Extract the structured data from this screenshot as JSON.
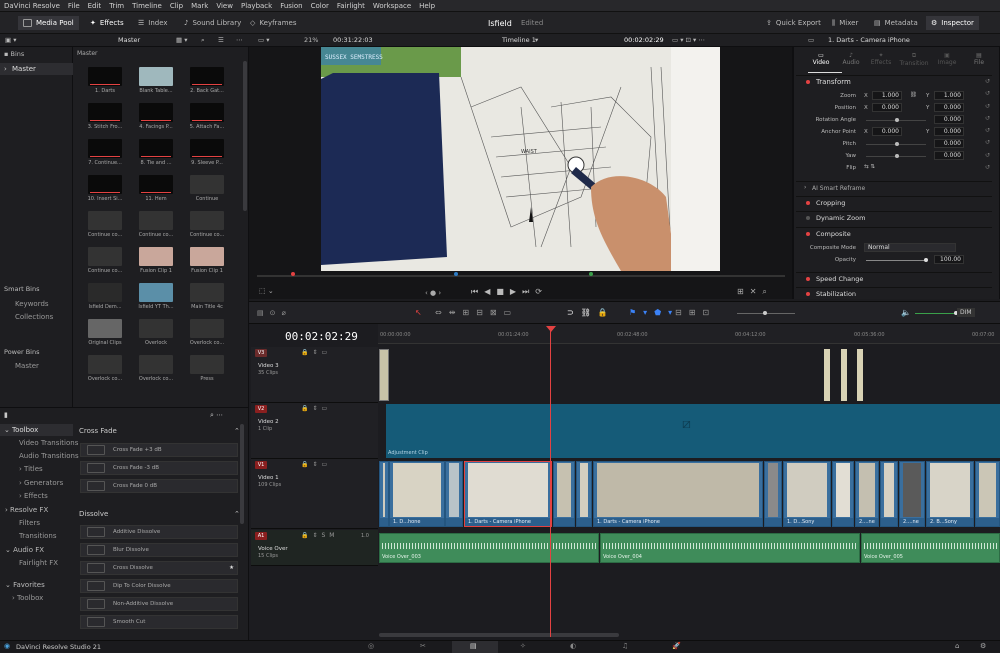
{
  "menubar": {
    "items": [
      "DaVinci Resolve",
      "File",
      "Edit",
      "Trim",
      "Timeline",
      "Clip",
      "Mark",
      "View",
      "Playback",
      "Fusion",
      "Color",
      "Fairlight",
      "Workspace",
      "Help"
    ]
  },
  "toolbar": {
    "media_pool": "Media Pool",
    "effects": "Effects",
    "index": "Index",
    "sound_library": "Sound Library",
    "keyframes": "Keyframes",
    "project_name": "Isfield",
    "project_status": "Edited",
    "quick_export": "Quick Export",
    "mixer": "Mixer",
    "metadata": "Metadata",
    "inspector": "Inspector"
  },
  "subbar": {
    "bin_name": "Master",
    "zoom": "21%",
    "source_tc": "00:31:22:03",
    "timeline_name": "Timeline 1",
    "record_tc": "00:02:02:29",
    "clip_name": "1. Darts - Camera iPhone"
  },
  "bins": {
    "header": "Bins",
    "master": "Master",
    "smart_bins": "Smart Bins",
    "smart_items": [
      "Keywords",
      "Collections"
    ],
    "power_bins": "Power Bins",
    "power_items": [
      "Master"
    ]
  },
  "media_pool": {
    "header": "Master",
    "clips": [
      "1. Darts",
      "Blank Table...",
      "2. Back Gat...",
      "3. Stitch Fro...",
      "4. Facings P...",
      "5. Attach Fa...",
      "7. Continue...",
      "8. Tie and ...",
      "9. Sleeve P...",
      "10. Insert Si...",
      "11. Hem",
      "Continue",
      "Continue co...",
      "Continue co...",
      "Continue co...",
      "Continue co...",
      "Fusion Clip 1",
      "Fusion Clip 1",
      "Isfield Dem...",
      "Isfield YT Th...",
      "Main Title 4c",
      "Original Clips",
      "Overlock",
      "Overlock co...",
      "Overlock co...",
      "Overlock co...",
      "Press"
    ]
  },
  "toolbox": {
    "items": [
      "Toolbox",
      "Video Transitions",
      "Audio Transitions",
      "Titles",
      "Generators",
      "Effects",
      "Resolve FX",
      "Filters",
      "Transitions",
      "Audio FX",
      "Fairlight FX",
      "Favorites",
      "Toolbox"
    ],
    "cross_fade_header": "Cross Fade",
    "cross_fade": [
      "Cross Fade +3 dB",
      "Cross Fade -3 dB",
      "Cross Fade 0 dB"
    ],
    "dissolve_header": "Dissolve",
    "dissolve": [
      "Additive Dissolve",
      "Blur Dissolve",
      "Cross Dissolve",
      "Dip To Color Dissolve",
      "Non-Additive Dissolve",
      "Smooth Cut"
    ]
  },
  "viewer": {
    "overlay_text": "SUSSEX SEMSTRESS",
    "pattern_label": "WAIST"
  },
  "inspector": {
    "tabs": [
      "Video",
      "Audio",
      "Effects",
      "Transition",
      "Image",
      "File"
    ],
    "transform": "Transform",
    "zoom_label": "Zoom",
    "zoom_x": "1.000",
    "zoom_y": "1.000",
    "position_label": "Position",
    "pos_x": "0.000",
    "pos_y": "0.000",
    "rotation_label": "Rotation Angle",
    "rotation": "0.000",
    "anchor_label": "Anchor Point",
    "anchor_x": "0.000",
    "anchor_y": "0.000",
    "pitch_label": "Pitch",
    "pitch": "0.000",
    "yaw_label": "Yaw",
    "yaw": "0.000",
    "flip_label": "Flip",
    "smart_reframe": "AI Smart Reframe",
    "cropping": "Cropping",
    "dynamic_zoom": "Dynamic Zoom",
    "composite": "Composite",
    "composite_mode_label": "Composite Mode",
    "composite_mode": "Normal",
    "opacity_label": "Opacity",
    "opacity": "100.00",
    "speed_change": "Speed Change",
    "stabilization": "Stabilization"
  },
  "timeline": {
    "timecode": "00:02:02:29",
    "ruler": [
      "00:00:00:00",
      "00:01:24:00",
      "00:02:48:00",
      "00:04:12:00",
      "00:05:36:00",
      "00:07:00"
    ],
    "tracks": [
      {
        "badge": "V3",
        "name": "Video 3",
        "count": "35 Clips"
      },
      {
        "badge": "V2",
        "name": "Video 2",
        "count": "1 Clip"
      },
      {
        "badge": "V1",
        "name": "Video 1",
        "count": "109 Clips"
      },
      {
        "badge": "A1",
        "name": "Voice Over",
        "count": "15 Clips",
        "level": "1.0"
      }
    ],
    "adjustment_clip": "Adjustment Clip",
    "v1_clips": [
      "1. D...hone",
      "1. Darts - Camera iPhone",
      "1. Darts - Camera iPhone",
      "1. D...Sony",
      "2....ne",
      "2....ne",
      "2. B...Sony",
      "...ne",
      "...ne"
    ],
    "audio_clips": [
      "Voice Over_003",
      "Voice Over_004",
      "Voice Over_005"
    ],
    "dim": "DIM"
  },
  "footer": {
    "app": "DaVinci Resolve Studio 21"
  },
  "colors": {
    "accent_red": "#e34242",
    "clip_blue": "#3a6f9e",
    "audio_green": "#3f8c5a",
    "adjust_teal": "#155b78"
  }
}
